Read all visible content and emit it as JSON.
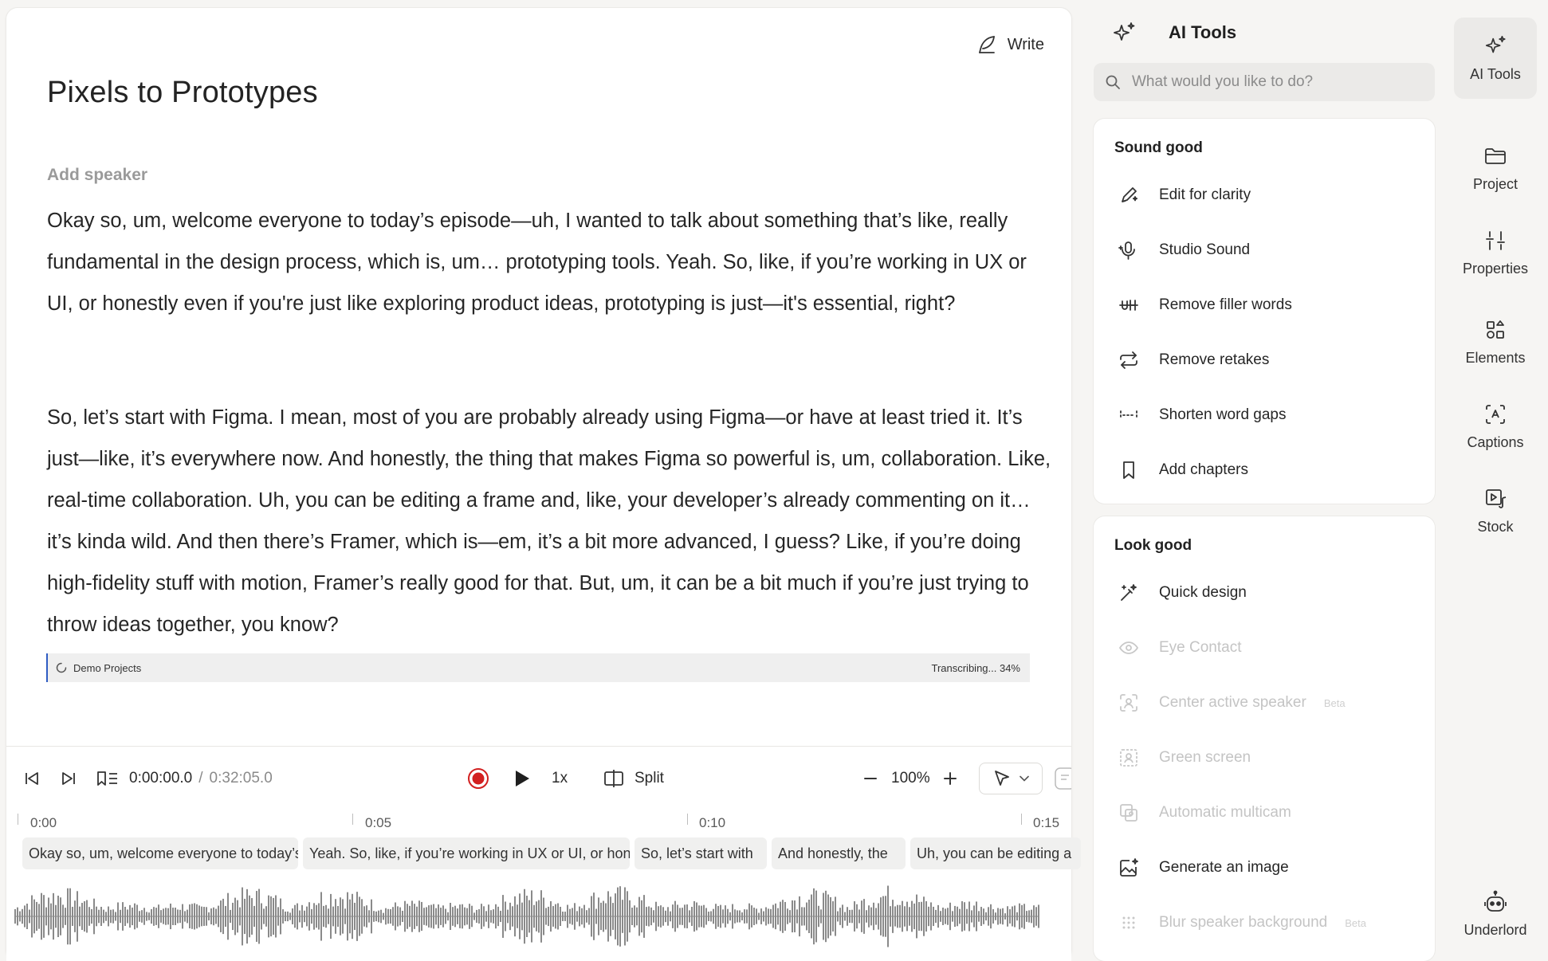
{
  "editor": {
    "write_label": "Write",
    "title": "Pixels to Prototypes",
    "speaker_placeholder": "Add speaker",
    "paragraphs": [
      "Okay so, um, welcome everyone to today’s episode—uh, I wanted to talk about something that’s like, really fundamental in the design process, which is, um… prototyping tools. Yeah. So, like, if you’re working in UX or UI, or honestly even if you're just like exploring product ideas, prototyping is just—it's essential, right?",
      "So, let’s start with Figma. I mean, most of you are probably already using Figma—or have at least tried it. It’s just—like, it’s everywhere now. And honestly, the thing that makes Figma so powerful is, um, collaboration. Like, real-time collaboration. Uh, you can be editing a frame and, like, your developer’s already commenting on it… it’s kinda wild. And then there’s Framer, which is—em, it’s a bit more advanced, I guess? Like, if you’re doing high-fidelity stuff with motion, Framer’s really good for that. But, um, it can be a bit much if you’re just trying to throw ideas together, you know?"
    ],
    "status": {
      "project": "Demo Projects",
      "progress_text": "Transcribing... 34%",
      "progress": 0.34
    }
  },
  "timeline": {
    "current_time": "0:00:00.0",
    "separator": "/",
    "duration": "0:32:05.0",
    "speed": "1x",
    "split_label": "Split",
    "zoom": "100%",
    "ruler": [
      "0:00",
      "0:05",
      "0:10",
      "0:15"
    ],
    "clips": [
      "Okay so, um, welcome everyone to today’s episode",
      "Yeah. So, like, if you’re working in UX or UI, or honestly",
      "So, let’s start with",
      "And honestly, the",
      "Uh, you can be editing a"
    ]
  },
  "ai_tools": {
    "title": "AI Tools",
    "search_placeholder": "What would you like to do?",
    "sections": [
      {
        "title": "Sound good",
        "items": [
          {
            "label": "Edit for clarity",
            "icon": "pen-sparkle-icon",
            "enabled": true
          },
          {
            "label": "Studio Sound",
            "icon": "mic-sparkle-icon",
            "enabled": true
          },
          {
            "label": "Remove filler words",
            "icon": "strikethrough-icon",
            "enabled": true
          },
          {
            "label": "Remove retakes",
            "icon": "repeat-icon",
            "enabled": true
          },
          {
            "label": "Shorten word gaps",
            "icon": "gap-icon",
            "enabled": true
          },
          {
            "label": "Add chapters",
            "icon": "bookmark-icon",
            "enabled": true
          }
        ]
      },
      {
        "title": "Look good",
        "items": [
          {
            "label": "Quick design",
            "icon": "magic-brush-icon",
            "enabled": true
          },
          {
            "label": "Eye Contact",
            "icon": "eye-icon",
            "enabled": false
          },
          {
            "label": "Center active speaker",
            "icon": "center-speaker-icon",
            "enabled": false,
            "badge": "Beta"
          },
          {
            "label": "Green screen",
            "icon": "green-screen-icon",
            "enabled": false
          },
          {
            "label": "Automatic multicam",
            "icon": "multicam-icon",
            "enabled": false
          },
          {
            "label": "Generate an image",
            "icon": "image-sparkle-icon",
            "enabled": true
          },
          {
            "label": "Blur speaker background",
            "icon": "blur-icon",
            "enabled": false,
            "badge": "Beta"
          }
        ]
      }
    ]
  },
  "rail": {
    "items": [
      "AI Tools",
      "Project",
      "Properties",
      "Elements",
      "Captions",
      "Stock"
    ],
    "bottom": "Underlord"
  },
  "colors": {
    "accent": "#2f5cc3",
    "record": "#d21f1f",
    "waveform": "#8a8a8a",
    "disabled_text": "#c4c4c4"
  }
}
